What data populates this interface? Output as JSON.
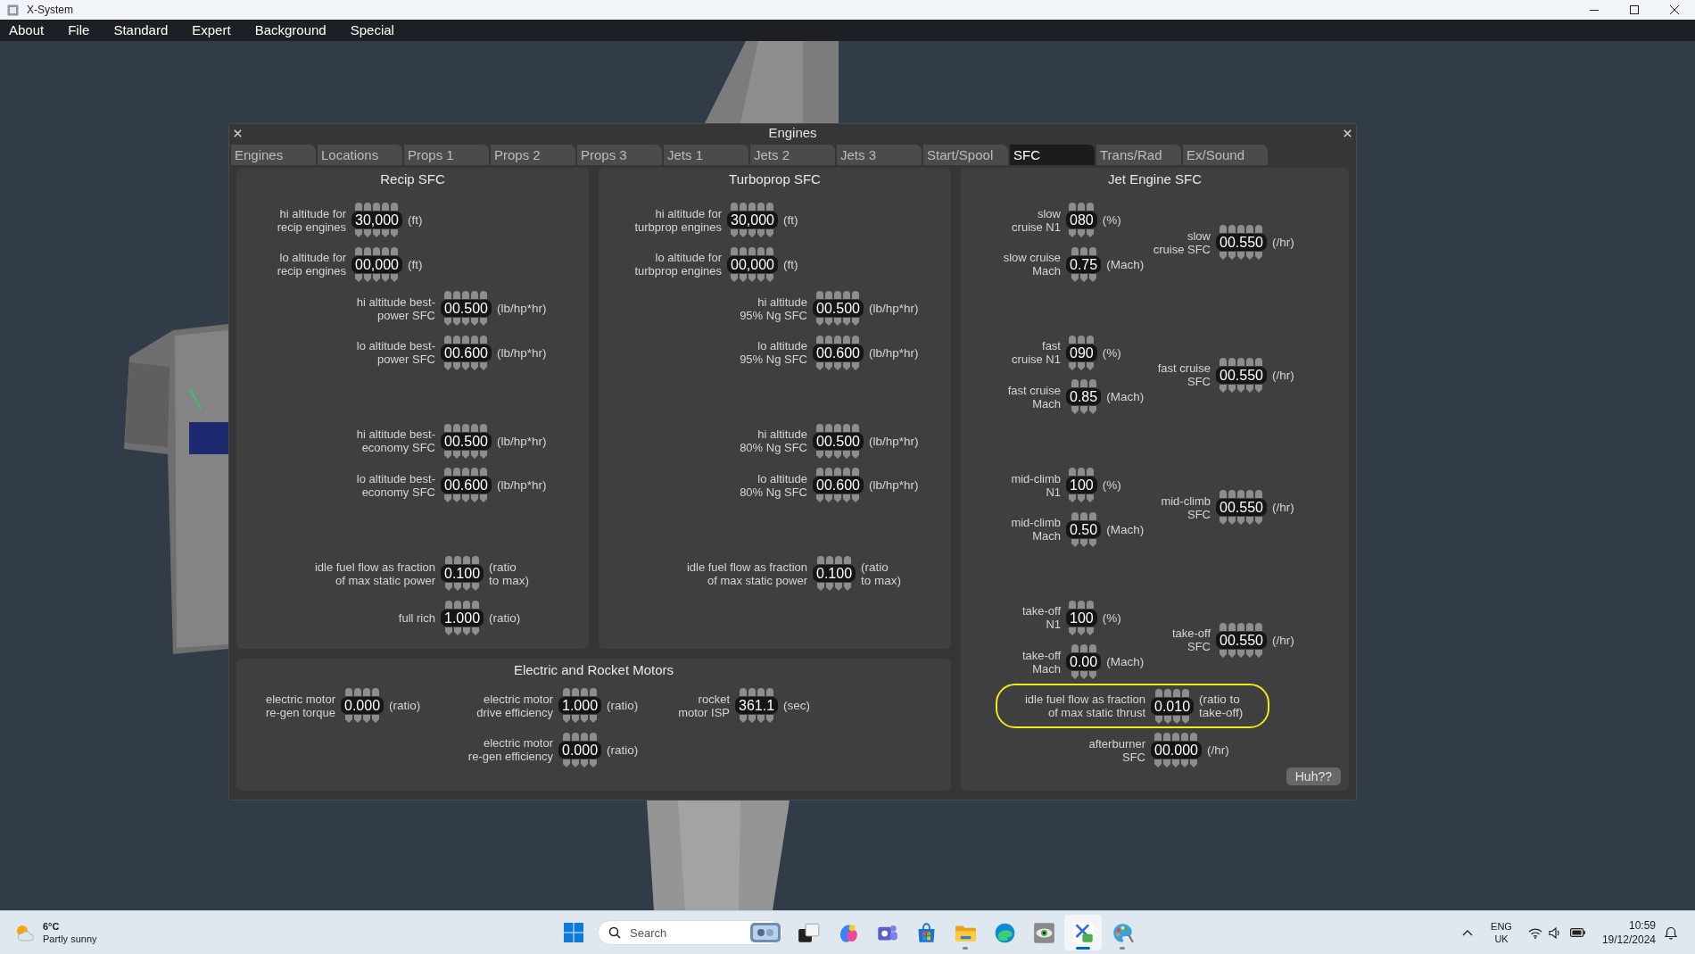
{
  "window": {
    "title": "X-System"
  },
  "menu": [
    {
      "label": "About"
    },
    {
      "label": "File"
    },
    {
      "label": "Standard"
    },
    {
      "label": "Expert"
    },
    {
      "label": "Background"
    },
    {
      "label": "Special"
    }
  ],
  "dialog": {
    "title": "Engines",
    "tabs": [
      {
        "label": "Engines",
        "selected": false
      },
      {
        "label": "Locations",
        "selected": false
      },
      {
        "label": "Props 1",
        "selected": false
      },
      {
        "label": "Props 2",
        "selected": false
      },
      {
        "label": "Props 3",
        "selected": false
      },
      {
        "label": "Jets 1",
        "selected": false
      },
      {
        "label": "Jets 2",
        "selected": false
      },
      {
        "label": "Jets 3",
        "selected": false
      },
      {
        "label": "Start/Spool",
        "selected": false
      },
      {
        "label": "SFC",
        "selected": true
      },
      {
        "label": "Trans/Rad",
        "selected": false
      },
      {
        "label": "Ex/Sound",
        "selected": false
      }
    ],
    "recip_sfc": {
      "title": "Recip SFC",
      "fields": [
        {
          "label": "hi altitude for\nrecip engines",
          "value": "30,000",
          "unit": "(ft)"
        },
        {
          "label": "lo altitude for\nrecip engines",
          "value": "00,000",
          "unit": "(ft)"
        },
        {
          "label": "hi altitude best-\npower SFC",
          "value": "00.500",
          "unit": "(lb/hp*hr)"
        },
        {
          "label": "lo altitude best-\npower SFC",
          "value": "00.600",
          "unit": "(lb/hp*hr)"
        },
        {
          "label": "hi altitude best-\neconomy SFC",
          "value": "00.500",
          "unit": "(lb/hp*hr)"
        },
        {
          "label": "lo altitude best-\neconomy SFC",
          "value": "00.600",
          "unit": "(lb/hp*hr)"
        },
        {
          "label": "idle fuel flow as fraction\nof max static power",
          "value": "0.100",
          "unit": "(ratio\nto max)"
        },
        {
          "label": "full rich",
          "value": "1.000",
          "unit": "(ratio)"
        }
      ]
    },
    "turboprop_sfc": {
      "title": "Turboprop SFC",
      "fields": [
        {
          "label": "hi altitude for\nturbprop engines",
          "value": "30,000",
          "unit": "(ft)"
        },
        {
          "label": "lo altitude for\nturbprop engines",
          "value": "00,000",
          "unit": "(ft)"
        },
        {
          "label": "hi altitude\n95% Ng SFC",
          "value": "00.500",
          "unit": "(lb/hp*hr)"
        },
        {
          "label": "lo altitude\n95% Ng SFC",
          "value": "00.600",
          "unit": "(lb/hp*hr)"
        },
        {
          "label": "hi altitude\n80% Ng SFC",
          "value": "00.500",
          "unit": "(lb/hp*hr)"
        },
        {
          "label": "lo altitude\n80% Ng SFC",
          "value": "00.600",
          "unit": "(lb/hp*hr)"
        },
        {
          "label": "idle fuel flow as fraction\nof max static power",
          "value": "0.100",
          "unit": "(ratio\nto max)"
        }
      ]
    },
    "jet_engine_sfc": {
      "title": "Jet Engine SFC",
      "regimes": [
        {
          "n1": {
            "label": "slow\ncruise N1",
            "value": "080",
            "unit": "(%)"
          },
          "mach": {
            "label": "slow cruise\nMach",
            "value": "0.75",
            "unit": "(Mach)"
          },
          "sfc": {
            "label": "slow\ncruise SFC",
            "value": "00.550",
            "unit": "(/hr)"
          }
        },
        {
          "n1": {
            "label": "fast\ncruise N1",
            "value": "090",
            "unit": "(%)"
          },
          "mach": {
            "label": "fast cruise\nMach",
            "value": "0.85",
            "unit": "(Mach)"
          },
          "sfc": {
            "label": "fast cruise\nSFC",
            "value": "00.550",
            "unit": "(/hr)"
          }
        },
        {
          "n1": {
            "label": "mid-climb\nN1",
            "value": "100",
            "unit": "(%)"
          },
          "mach": {
            "label": "mid-climb\nMach",
            "value": "0.50",
            "unit": "(Mach)"
          },
          "sfc": {
            "label": "mid-climb\nSFC",
            "value": "00.550",
            "unit": "(/hr)"
          }
        },
        {
          "n1": {
            "label": "take-off\nN1",
            "value": "100",
            "unit": "(%)"
          },
          "mach": {
            "label": "take-off\nMach",
            "value": "0.00",
            "unit": "(Mach)"
          },
          "sfc": {
            "label": "take-off\nSFC",
            "value": "00.550",
            "unit": "(/hr)"
          }
        }
      ],
      "idle_fuel_flow": {
        "label": "idle fuel flow as fraction\nof max static thrust",
        "value": "0.010",
        "unit": "(ratio to\ntake-off)",
        "highlighted": true
      },
      "afterburner_sfc": {
        "label": "afterburner\nSFC",
        "value": "00.000",
        "unit": "(/hr)"
      },
      "help_button": "Huh??"
    },
    "electric_and_rocket_motors": {
      "title": "Electric and Rocket Motors",
      "fields": [
        {
          "label": "electric motor\nre-gen torque",
          "value": "0.000",
          "unit": "(ratio)"
        },
        {
          "label": "electric motor\ndrive efficiency",
          "value": "1.000",
          "unit": "(ratio)"
        },
        {
          "label": "rocket\nmotor ISP",
          "value": "361.1",
          "unit": "(sec)"
        },
        {
          "label": "electric motor\nre-gen efficiency",
          "value": "0.000",
          "unit": "(ratio)"
        }
      ]
    }
  },
  "taskbar": {
    "weather": {
      "temperature": "6°C",
      "condition": "Partly sunny"
    },
    "search": {
      "placeholder": "Search"
    },
    "apps": [
      {
        "running": false,
        "active": false
      },
      {
        "running": false,
        "active": false
      },
      {
        "running": false,
        "active": false
      },
      {
        "running": false,
        "active": false
      },
      {
        "running": true,
        "active": false
      },
      {
        "running": false,
        "active": false
      },
      {
        "running": false,
        "active": false
      },
      {
        "running": true,
        "active": true
      },
      {
        "running": true,
        "active": false
      }
    ],
    "tray": {
      "language": "ENG",
      "keyboard": "UK",
      "time": "10:59",
      "date": "19/12/2024"
    }
  }
}
